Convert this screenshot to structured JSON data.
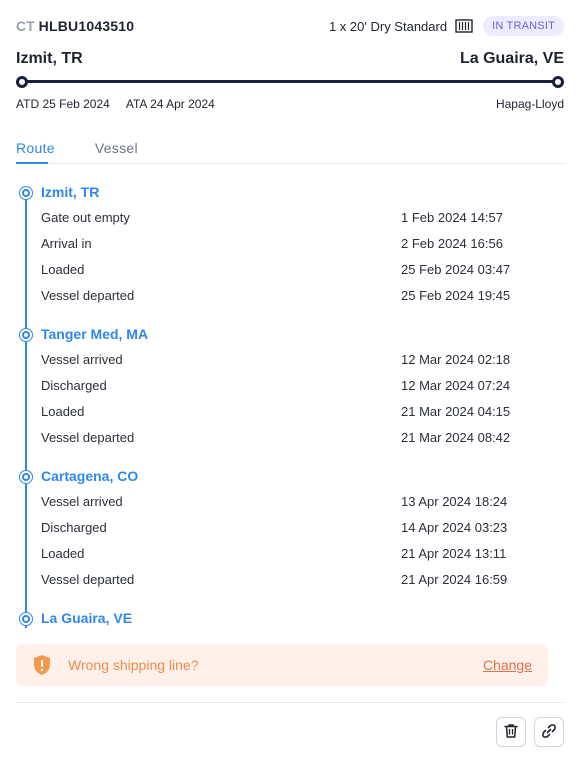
{
  "header": {
    "prefix": "CT",
    "container_number": "HLBU1043510",
    "equipment": "1 x 20' Dry Standard",
    "container_icon": "container-icon",
    "status": "IN TRANSIT",
    "status_color": "#6c63d9"
  },
  "route_summary": {
    "origin": "Izmit, TR",
    "destination": "La Guaira, VE",
    "atd": "ATD 25 Feb 2024",
    "ata": "ATA 24 Apr 2024",
    "carrier": "Hapag-Lloyd"
  },
  "tabs": [
    {
      "label": "Route",
      "active": true
    },
    {
      "label": "Vessel",
      "active": false
    }
  ],
  "stops": [
    {
      "name": "Izmit, TR",
      "events": [
        {
          "name": "Gate out empty",
          "time": "1 Feb 2024 14:57"
        },
        {
          "name": "Arrival in",
          "time": "2 Feb 2024 16:56"
        },
        {
          "name": "Loaded",
          "time": "25 Feb 2024 03:47"
        },
        {
          "name": "Vessel departed",
          "time": "25 Feb 2024 19:45"
        }
      ]
    },
    {
      "name": "Tanger Med, MA",
      "events": [
        {
          "name": "Vessel arrived",
          "time": "12 Mar 2024 02:18"
        },
        {
          "name": "Discharged",
          "time": "12 Mar 2024 07:24"
        },
        {
          "name": "Loaded",
          "time": "21 Mar 2024 04:15"
        },
        {
          "name": "Vessel departed",
          "time": "21 Mar 2024 08:42"
        }
      ]
    },
    {
      "name": "Cartagena, CO",
      "events": [
        {
          "name": "Vessel arrived",
          "time": "13 Apr 2024 18:24"
        },
        {
          "name": "Discharged",
          "time": "14 Apr 2024 03:23"
        },
        {
          "name": "Loaded",
          "time": "21 Apr 2024 13:11"
        },
        {
          "name": "Vessel departed",
          "time": "21 Apr 2024 16:59"
        }
      ]
    },
    {
      "name": "La Guaira, VE",
      "events": []
    }
  ],
  "warning": {
    "icon": "shield-warning-icon",
    "text": "Wrong shipping line?",
    "link": "Change"
  },
  "actions": {
    "delete_icon": "trash-icon",
    "link_icon": "link-icon"
  },
  "colors": {
    "accent": "#2f88e6",
    "warning_bg": "#fff1ea",
    "warning_text": "#f08c4a"
  }
}
